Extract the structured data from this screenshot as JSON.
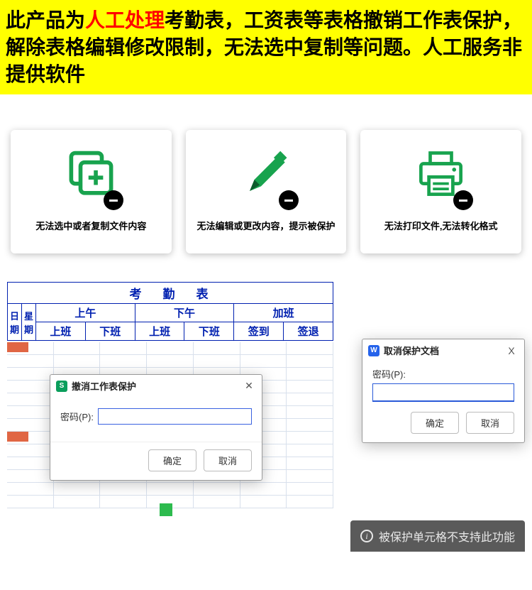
{
  "banner": {
    "prefix": "此产品为",
    "highlight": "人工处理",
    "suffix": "考勤表，工资表等表格撤销工作表保护，解除表格编辑修改限制，无法选中复制等问题。人工服务非提供软件"
  },
  "cards": [
    {
      "label": "无法选中或者复制文件内容",
      "icon": "copy-plus"
    },
    {
      "label": "无法编辑或更改内容，提示被保护",
      "icon": "pencil"
    },
    {
      "label": "无法打印文件,无法转化格式",
      "icon": "printer"
    }
  ],
  "attendance": {
    "title": "考勤表",
    "col_left1": "日期",
    "col_left2": "星期",
    "groups": [
      "上午",
      "下午",
      "加班"
    ],
    "subcols": [
      "上班",
      "下班",
      "上班",
      "下班",
      "签到",
      "签退"
    ]
  },
  "dialog1": {
    "title": "撤消工作表保护",
    "password_label": "密码(P):",
    "ok": "确定",
    "cancel": "取消"
  },
  "dialog2": {
    "title": "取消保护文档",
    "password_label": "密码(P):",
    "ok": "确定",
    "cancel": "取消",
    "close_x": "X"
  },
  "toast": {
    "text": "被保护单元格不支持此功能"
  }
}
